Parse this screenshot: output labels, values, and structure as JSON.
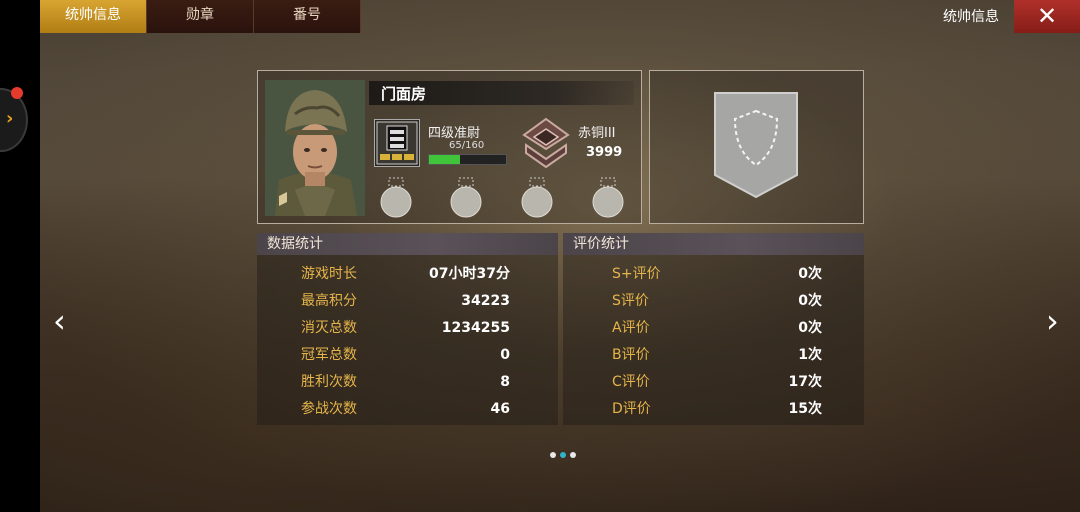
{
  "tabs": [
    {
      "label": "统帅信息",
      "active": true
    },
    {
      "label": "勋章",
      "active": false
    },
    {
      "label": "番号",
      "active": false
    }
  ],
  "topbar": {
    "title": "统帅信息",
    "close_glyph": "✕"
  },
  "side_nav": {
    "prev_glyph": "‹",
    "next_glyph": "›",
    "side_handle_glyph": "›"
  },
  "profile": {
    "name": "门面房",
    "rank_title": "四级准尉",
    "xp_text": "65/160",
    "xp_progress": 0.406,
    "tier_name": "赤铜III",
    "tier_score": "3999",
    "medal_slots": 4
  },
  "stats": {
    "header": "数据统计",
    "rows": [
      {
        "label": "游戏时长",
        "value": "07小时37分"
      },
      {
        "label": "最高积分",
        "value": "34223"
      },
      {
        "label": "消灭总数",
        "value": "1234255"
      },
      {
        "label": "冠军总数",
        "value": "0"
      },
      {
        "label": "胜利次数",
        "value": "8"
      },
      {
        "label": "参战次数",
        "value": "46"
      }
    ]
  },
  "ratings": {
    "header": "评价统计",
    "rows": [
      {
        "label": "S+评价",
        "value": "0次"
      },
      {
        "label": "S评价",
        "value": "0次"
      },
      {
        "label": "A评价",
        "value": "0次"
      },
      {
        "label": "B评价",
        "value": "1次"
      },
      {
        "label": "C评价",
        "value": "17次"
      },
      {
        "label": "D评价",
        "value": "15次"
      }
    ]
  },
  "pager": {
    "count": 3,
    "active_index": 1
  },
  "colors": {
    "accent_gold": "#d9a531",
    "label_gold": "#e5b54a",
    "xp_green": "#3fc43a",
    "close_red": "#b0302a"
  }
}
